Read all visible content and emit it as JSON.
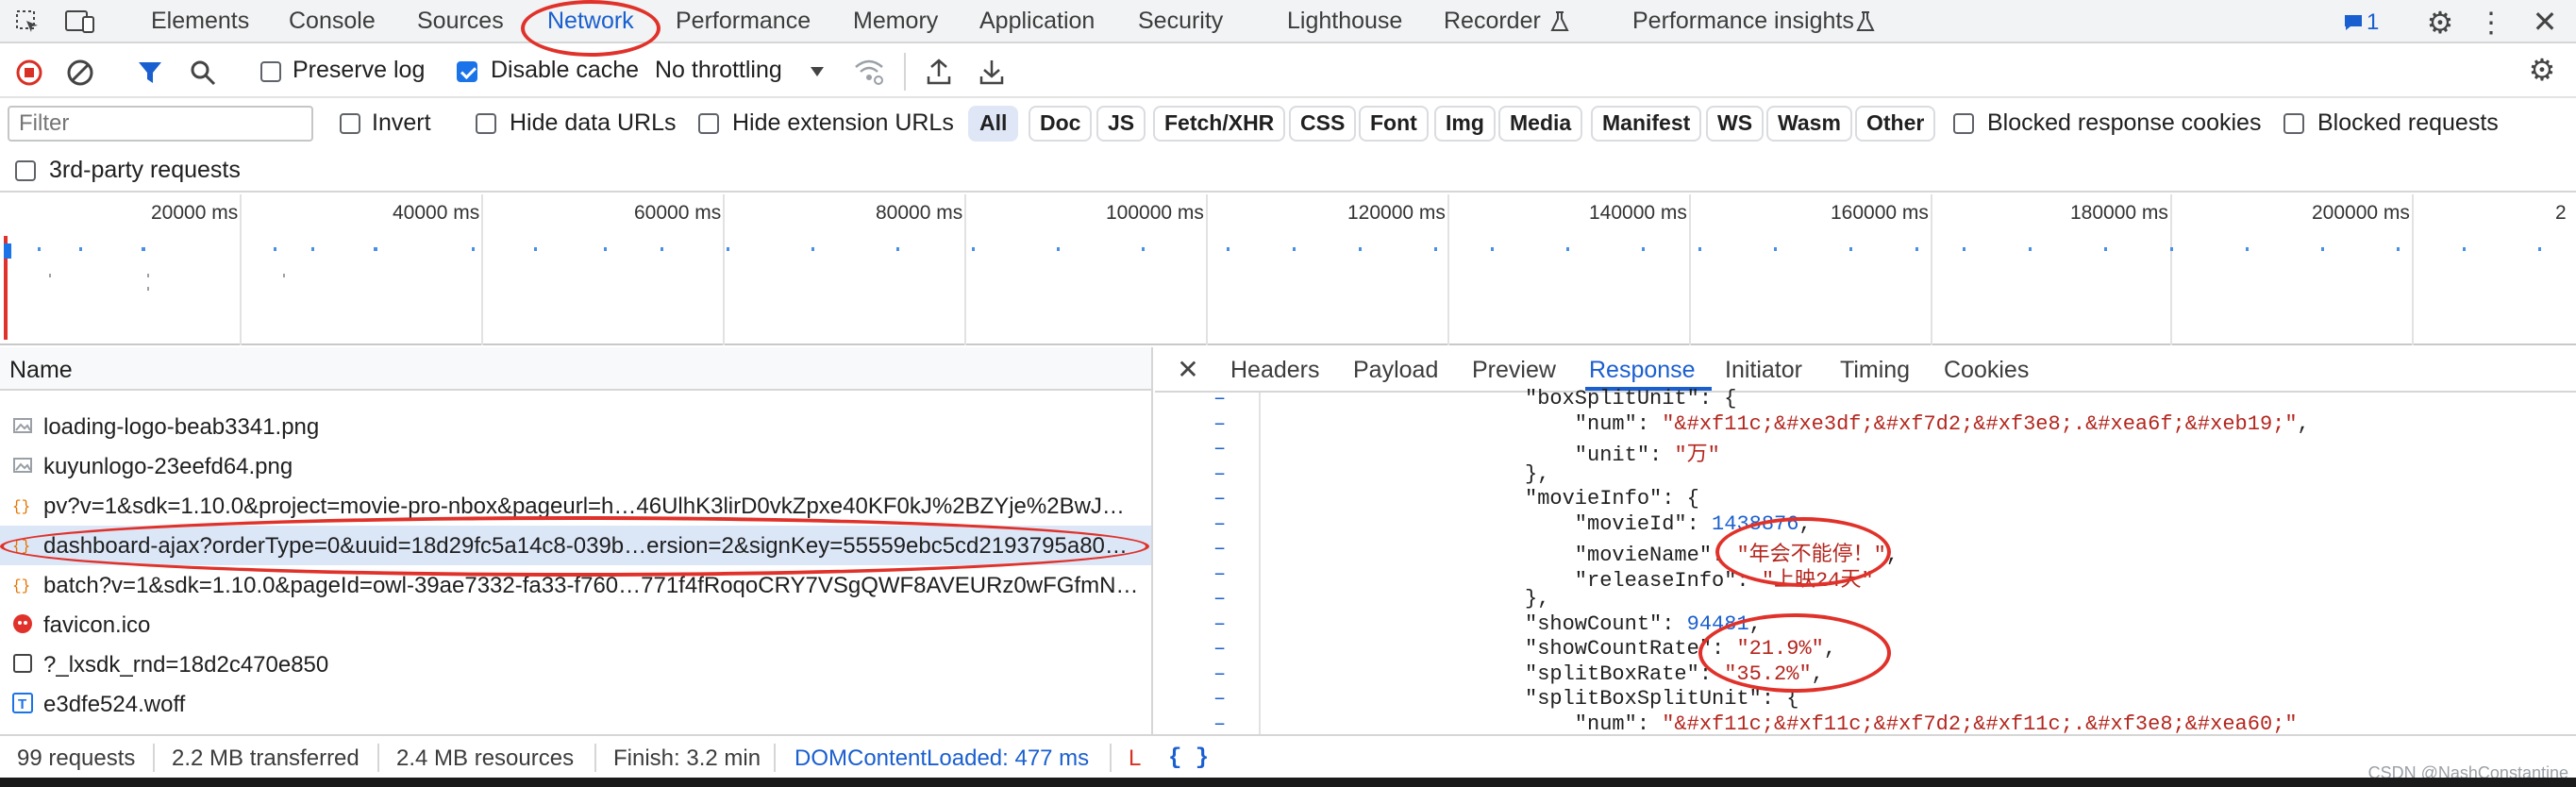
{
  "tabbar": {
    "tabs": [
      "Elements",
      "Console",
      "Sources",
      "Network",
      "Performance",
      "Memory",
      "Application",
      "Security",
      "Lighthouse",
      "Recorder",
      "Performance insights"
    ],
    "active": "Network",
    "issues_count": "1"
  },
  "toolbar": {
    "preserve_log": "Preserve log",
    "disable_cache": "Disable cache",
    "throttling": "No throttling"
  },
  "filterbar": {
    "filter_placeholder": "Filter",
    "invert": "Invert",
    "hide_data_urls": "Hide data URLs",
    "hide_extension_urls": "Hide extension URLs",
    "types": [
      "All",
      "Doc",
      "JS",
      "Fetch/XHR",
      "CSS",
      "Font",
      "Img",
      "Media",
      "Manifest",
      "WS",
      "Wasm",
      "Other"
    ],
    "active_type": "All",
    "blocked_response_cookies": "Blocked response cookies",
    "blocked_requests": "Blocked requests",
    "third_party": "3rd-party requests"
  },
  "overview": {
    "ticks": [
      "20000 ms",
      "40000 ms",
      "60000 ms",
      "80000 ms",
      "100000 ms",
      "120000 ms",
      "140000 ms",
      "160000 ms",
      "180000 ms",
      "200000 ms",
      "2"
    ]
  },
  "requests": {
    "header": "Name",
    "items": [
      {
        "name": "loading-logo-beab3341.png",
        "icon": "image-icon"
      },
      {
        "name": "kuyunlogo-23eefd64.png",
        "icon": "image-icon"
      },
      {
        "name": "pv?v=1&sdk=1.10.0&project=movie-pro-nbox&pageurl=h…46UlhK3lirD0vkZpxe40KF0kJ%2BZYje%2BwJ…",
        "icon": "fetch-icon"
      },
      {
        "name": "dashboard-ajax?orderType=0&uuid=18d29fc5a14c8-039b…ersion=2&signKey=55559ebc5cd2193795a80…",
        "icon": "fetch-icon",
        "selected": true
      },
      {
        "name": "batch?v=1&sdk=1.10.0&pageId=owl-39ae7332-fa33-f760…771f4fRoqoCRY7VSgQWF8AVEURz0wFGfmN…",
        "icon": "fetch-icon"
      },
      {
        "name": "favicon.ico",
        "icon": "favicon-icon"
      },
      {
        "name": "?_lxsdk_rnd=18d2c470e850",
        "icon": "document-icon"
      },
      {
        "name": "e3dfe524.woff",
        "icon": "font-icon"
      }
    ]
  },
  "detail": {
    "tabs": [
      "Headers",
      "Payload",
      "Preview",
      "Response",
      "Initiator",
      "Timing",
      "Cookies"
    ],
    "active": "Response",
    "lines": [
      {
        "t": "\"boxSplitUnit\": {"
      },
      {
        "k": "    \"num\": ",
        "s": "\"&#xf11c;&#xe3df;&#xf7d2;&#xf3e8;.&#xea6f;&#xeb19;\"",
        "e": ","
      },
      {
        "k": "    \"unit\": ",
        "s": "\"万\""
      },
      {
        "t": "},"
      },
      {
        "t": "\"movieInfo\": {"
      },
      {
        "k": "    \"movieId\": ",
        "n": "1438876",
        "e": ","
      },
      {
        "k": "    \"movieName\": ",
        "s": "\"年会不能停！\"",
        "e": ","
      },
      {
        "k": "    \"releaseInfo\": ",
        "s": "\"上映24天\""
      },
      {
        "t": "},"
      },
      {
        "k": "\"showCount\": ",
        "n": "94481",
        "e": ","
      },
      {
        "k": "\"showCountRate\": ",
        "s": "\"21.9%\"",
        "e": ","
      },
      {
        "k": "\"splitBoxRate\": ",
        "s": "\"35.2%\"",
        "e": ","
      },
      {
        "t": "\"splitBoxSplitUnit\": {"
      },
      {
        "k": "    \"num\": ",
        "s": "\"&#xf11c;&#xf11c;&#xf7d2;&#xf11c;.&#xf3e8;&#xea60;\""
      }
    ]
  },
  "status": {
    "requests": "99 requests",
    "transferred": "2.2 MB transferred",
    "resources": "2.4 MB resources",
    "finish": "Finish: 3.2 min",
    "domcontent": "DOMContentLoaded: 477 ms",
    "load": "L",
    "braces": "{ }"
  },
  "watermark": "CSDN @NashConstantine",
  "colors": {
    "accent": "#1a5fd0",
    "annotation": "#e0322a",
    "string": "#b3261e"
  }
}
